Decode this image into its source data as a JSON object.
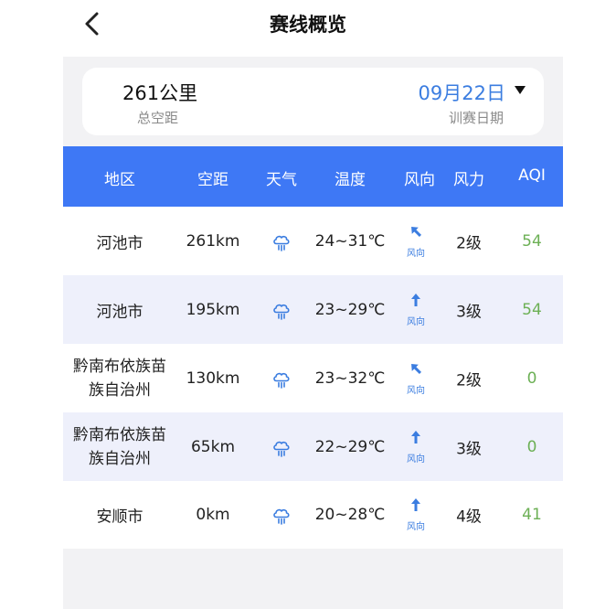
{
  "header": {
    "title": "赛线概览"
  },
  "summary": {
    "distance_value": "261公里",
    "distance_label": "总空距",
    "date_value": "09月22日",
    "date_label": "训赛日期"
  },
  "table": {
    "columns": [
      "地区",
      "空距",
      "天气",
      "温度",
      "风向",
      "风力",
      "AQI"
    ],
    "wind_label": "风向",
    "rows": [
      {
        "region_line1": "河池市",
        "region_line2": "",
        "distance": "261km",
        "weather_icon": "rain-cloud-icon",
        "temp": "24~31℃",
        "wind_dir": "northwest",
        "wind_force": "2级",
        "aqi": "54"
      },
      {
        "region_line1": "河池市",
        "region_line2": "",
        "distance": "195km",
        "weather_icon": "rain-cloud-icon",
        "temp": "23~29℃",
        "wind_dir": "north",
        "wind_force": "3级",
        "aqi": "54"
      },
      {
        "region_line1": "黔南布依族苗",
        "region_line2": "族自治州",
        "distance": "130km",
        "weather_icon": "rain-cloud-icon",
        "temp": "23~32℃",
        "wind_dir": "northwest",
        "wind_force": "2级",
        "aqi": "0"
      },
      {
        "region_line1": "黔南布依族苗",
        "region_line2": "族自治州",
        "distance": "65km",
        "weather_icon": "rain-cloud-icon",
        "temp": "22~29℃",
        "wind_dir": "north",
        "wind_force": "3级",
        "aqi": "0"
      },
      {
        "region_line1": "安顺市",
        "region_line2": "",
        "distance": "0km",
        "weather_icon": "rain-cloud-icon",
        "temp": "20~28℃",
        "wind_dir": "north",
        "wind_force": "4级",
        "aqi": "41"
      }
    ]
  },
  "colors": {
    "accent": "#3e78f5",
    "date_text": "#3b7de0",
    "aqi_good": "#6cb055",
    "alt_row": "#eef0fb",
    "panel_bg": "#f2f2f4"
  }
}
